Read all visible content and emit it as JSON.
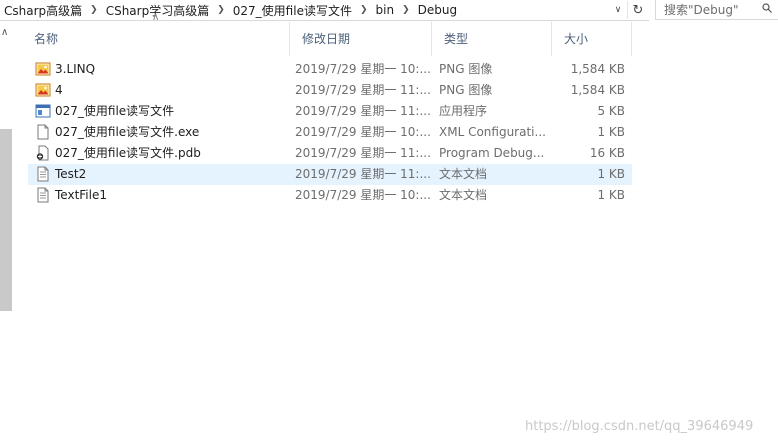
{
  "address": {
    "crumbs": [
      "Csharp高级篇",
      "CSharp学习高级篇",
      "027_使用file读写文件",
      "bin",
      "Debug"
    ],
    "search_placeholder": "搜索\"Debug\""
  },
  "columns": {
    "name": "名称",
    "date": "修改日期",
    "type": "类型",
    "size": "大小"
  },
  "files": [
    {
      "name": "3.LINQ",
      "date": "2019/7/29 星期一 10:...",
      "type": "PNG 图像",
      "size": "1,584 KB",
      "icon": "image-file-icon",
      "selected": false
    },
    {
      "name": "4",
      "date": "2019/7/29 星期一 11:...",
      "type": "PNG 图像",
      "size": "1,584 KB",
      "icon": "image-file-icon",
      "selected": false
    },
    {
      "name": "027_使用file读写文件",
      "date": "2019/7/29 星期一 11:...",
      "type": "应用程序",
      "size": "5 KB",
      "icon": "application-icon",
      "selected": false
    },
    {
      "name": "027_使用file读写文件.exe",
      "date": "2019/7/29 星期一 10:...",
      "type": "XML Configurati...",
      "size": "1 KB",
      "icon": "blank-file-icon",
      "selected": false
    },
    {
      "name": "027_使用file读写文件.pdb",
      "date": "2019/7/29 星期一 11:...",
      "type": "Program Debug...",
      "size": "16 KB",
      "icon": "debug-file-icon",
      "selected": false
    },
    {
      "name": "Test2",
      "date": "2019/7/29 星期一 11:...",
      "type": "文本文档",
      "size": "1 KB",
      "icon": "text-file-icon",
      "selected": true
    },
    {
      "name": "TextFile1",
      "date": "2019/7/29 星期一 10:...",
      "type": "文本文档",
      "size": "1 KB",
      "icon": "text-file-icon",
      "selected": false
    }
  ],
  "watermark": "https://blog.csdn.net/qq_39646949",
  "colors": {
    "selected_row": "#e5f3ff",
    "header_text": "#4c607a",
    "scroll_thumb": "#c9c9c9"
  }
}
